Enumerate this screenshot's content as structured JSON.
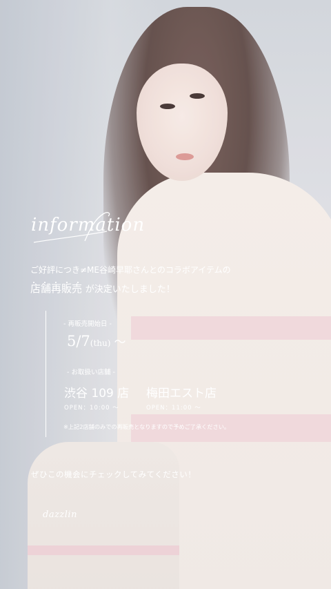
{
  "title": "information",
  "intro": {
    "line1": "ご好評につき≠ME谷崎早耶さんとのコラボアイテムの",
    "emphasis": "店舗再販売",
    "line2_rest": "が決定いたしました！"
  },
  "resale": {
    "label": "- 再販売開始日 -",
    "date": "5/7",
    "weekday": "(thu)",
    "tilde": "〜"
  },
  "stores": {
    "label": "- お取扱い店舗 -",
    "items": [
      {
        "name": "渋谷 109 店",
        "hours": "OPEN：10:00 〜"
      },
      {
        "name": "梅田エスト店",
        "hours": "OPEN：11:00 〜"
      }
    ],
    "note": "※上記2店舗のみでの再販売となりますので予めご了承ください。"
  },
  "cta": "ぜひこの機会にチェックしてみてください！",
  "brand": "dazzlin"
}
